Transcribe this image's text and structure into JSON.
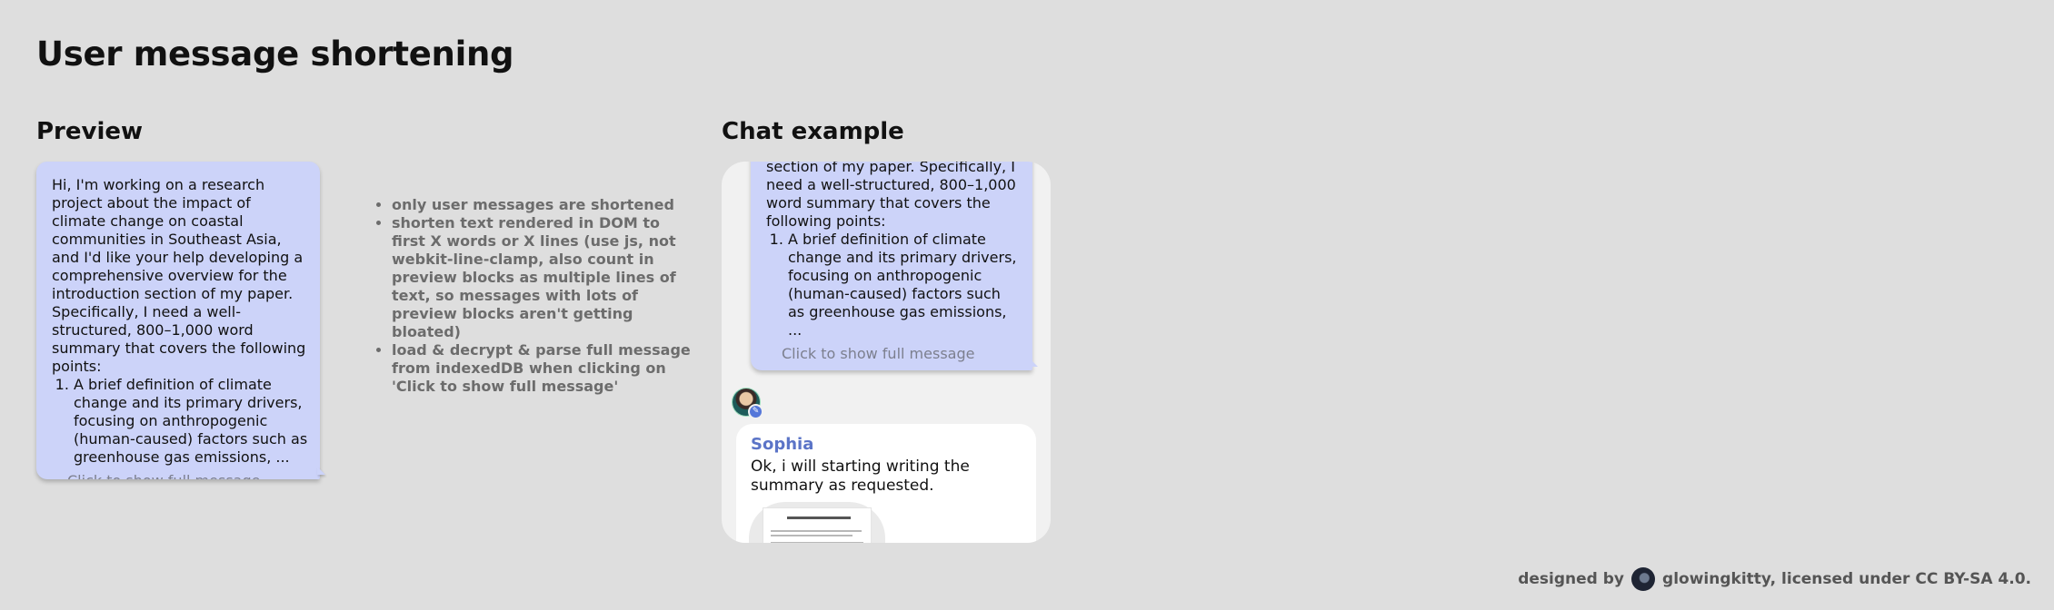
{
  "page": {
    "title": "User message shortening"
  },
  "preview": {
    "heading": "Preview",
    "message": {
      "intro": "Hi, I'm working on a research project about the impact of climate change on coastal communities in Southeast Asia, and I'd like your help developing a comprehensive overview for the introduction section of my paper. Specifically, I need a well-structured, 800–1,000 word summary that covers the following points:",
      "points": [
        "A brief definition of climate change and its primary drivers, focusing on anthropogenic (human-caused) factors such as greenhouse gas emissions, ..."
      ],
      "show_full_label": "Click to show full message"
    },
    "bubble_color": "#ccd3f9"
  },
  "notes": [
    "only user messages are shortened",
    "shorten text rendered in DOM to first X words or X lines (use js, not webkit-line-clamp, also count in preview blocks as multiple lines of text, so messages with lots of preview blocks aren't getting bloated)",
    "load & decrypt & parse full message from indexedDB when clicking on 'Click to show full message'"
  ],
  "chat_example": {
    "heading": "Chat example",
    "user_message": {
      "visible_text": "overview for the introduction section of my paper. Specifically, I need a well-structured, 800–1,000 word summary that covers the following points:",
      "points": [
        "A brief definition of climate change and its primary drivers, focusing on anthropogenic (human-caused) factors such as greenhouse gas emissions, ..."
      ],
      "show_full_label": "Click to show full message"
    },
    "reply": {
      "sender": "Sophia",
      "text": "Ok, i will starting writing the summary as requested.",
      "attachment_icon": "document-thumbnail"
    },
    "sender_color": "#5b74c7"
  },
  "footer": {
    "designed_by": "designed by",
    "credit": "glowingkitty, licensed under CC BY-SA 4.0."
  }
}
